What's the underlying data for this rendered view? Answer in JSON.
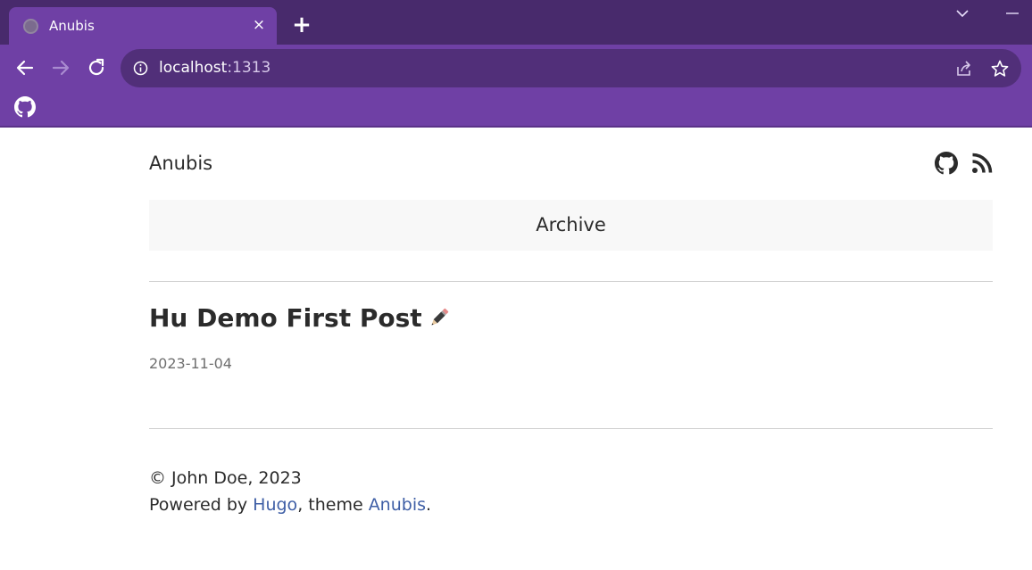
{
  "browser": {
    "tab_title": "Anubis",
    "tab_close": "×",
    "new_tab": "+",
    "url_host": "localhost",
    "url_port": ":1313"
  },
  "site": {
    "title": "Anubis",
    "menu": [
      {
        "label": "Archive"
      }
    ]
  },
  "post": {
    "title": "Hu Demo First Post",
    "date": "2023-11-04"
  },
  "footer": {
    "copyright": "© John Doe, 2023",
    "powered_prefix": "Powered by ",
    "hugo_link": "Hugo",
    "theme_prefix": ", theme ",
    "theme_link": "Anubis",
    "theme_suffix": "."
  },
  "colors": {
    "tabstrip": "#482a6c",
    "toolbar": "#6f40a5",
    "omnibox": "#512f79",
    "link": "#3f5fa6",
    "menu_bg": "#f8f8f8"
  },
  "icons": {
    "bookmark": "github-icon",
    "social": [
      "github-icon",
      "rss-icon"
    ],
    "post_title_emoji": "pencil-icon"
  }
}
